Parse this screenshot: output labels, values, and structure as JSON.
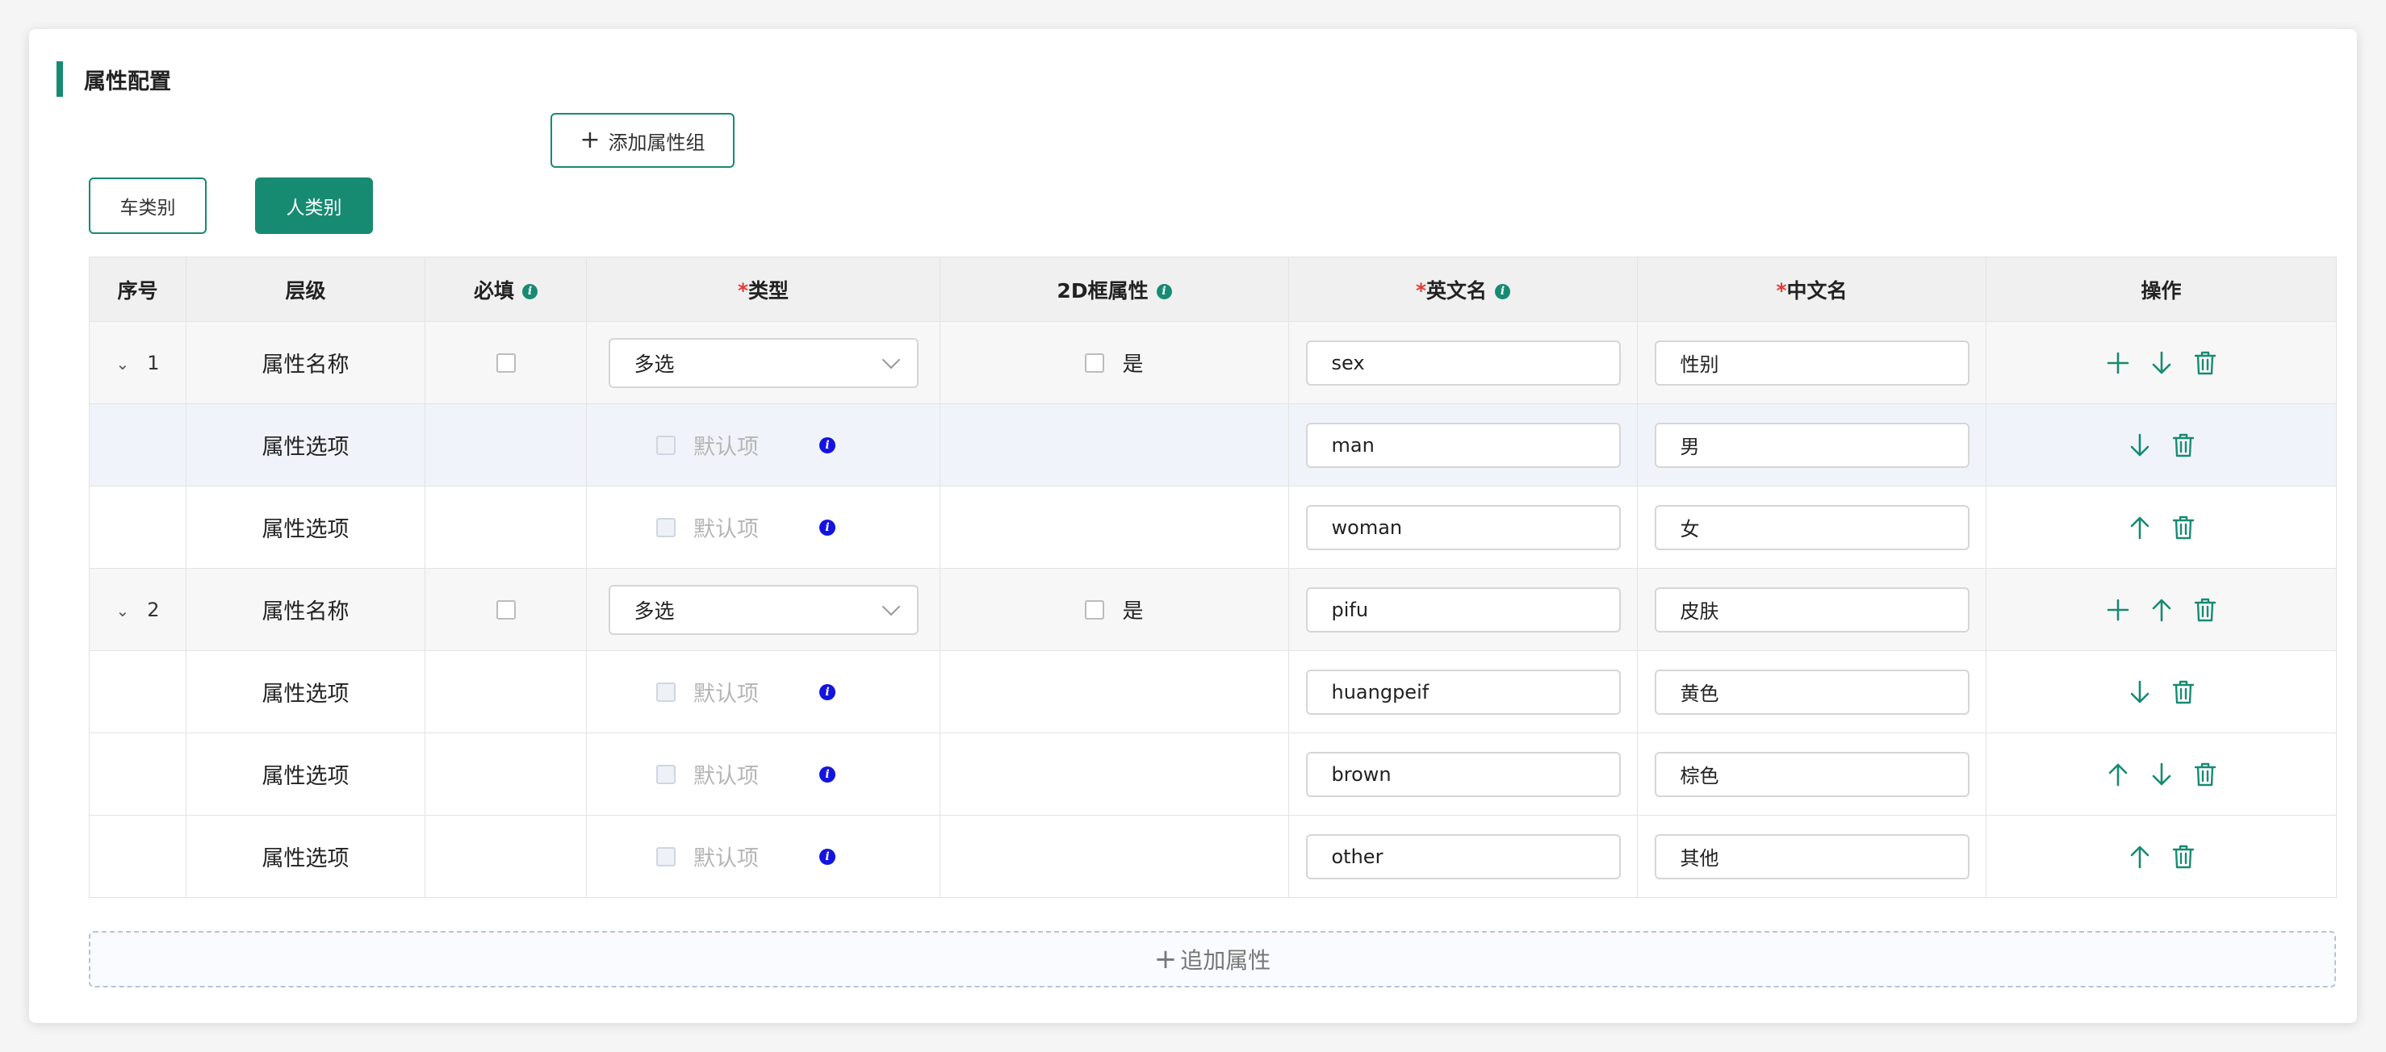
{
  "section": {
    "title": "属性配置"
  },
  "toolbar": {
    "add_group_label": "添加属性组"
  },
  "categories": [
    {
      "label": "车类别",
      "active": false
    },
    {
      "label": "人类别",
      "active": true
    }
  ],
  "columns": {
    "seq": "序号",
    "level": "层级",
    "required": "必填",
    "type": "类型",
    "twod": "2D框属性",
    "en_name": "英文名",
    "cn_name": "中文名",
    "ops": "操作",
    "required_marker": "*"
  },
  "labels": {
    "attr_name": "属性名称",
    "attr_option": "属性选项",
    "default_item": "默认项",
    "twod_yes": "是"
  },
  "rows": [
    {
      "kind": "parent",
      "seq": "1",
      "level": "属性名称",
      "type": "多选",
      "twod_label": "是",
      "en": "sex",
      "cn": "性别",
      "ops": [
        "plus-icon",
        "arrow-down-icon",
        "trash-icon"
      ]
    },
    {
      "kind": "option",
      "level": "属性选项",
      "default_label": "默认项",
      "en": "man",
      "cn": "男",
      "ops": [
        "arrow-down-icon",
        "trash-icon"
      ]
    },
    {
      "kind": "option",
      "level": "属性选项",
      "default_label": "默认项",
      "en": "woman",
      "cn": "女",
      "ops": [
        "arrow-up-icon",
        "trash-icon"
      ]
    },
    {
      "kind": "parent",
      "seq": "2",
      "level": "属性名称",
      "type": "多选",
      "twod_label": "是",
      "en": "pifu",
      "cn": "皮肤",
      "ops": [
        "plus-icon",
        "arrow-up-icon",
        "trash-icon"
      ]
    },
    {
      "kind": "option",
      "level": "属性选项",
      "default_label": "默认项",
      "en": "huangpeif",
      "cn": "黄色",
      "ops": [
        "arrow-down-icon",
        "trash-icon"
      ]
    },
    {
      "kind": "option",
      "level": "属性选项",
      "default_label": "默认项",
      "en": "brown",
      "cn": "棕色",
      "ops": [
        "arrow-up-icon",
        "arrow-down-icon",
        "trash-icon"
      ]
    },
    {
      "kind": "option",
      "level": "属性选项",
      "default_label": "默认项",
      "en": "other",
      "cn": "其他",
      "ops": [
        "arrow-up-icon",
        "trash-icon"
      ]
    }
  ],
  "footer": {
    "add_attr_label": "追加属性"
  },
  "colors": {
    "accent": "#178a72",
    "info_blue": "#1414e0",
    "required": "#e53935"
  }
}
